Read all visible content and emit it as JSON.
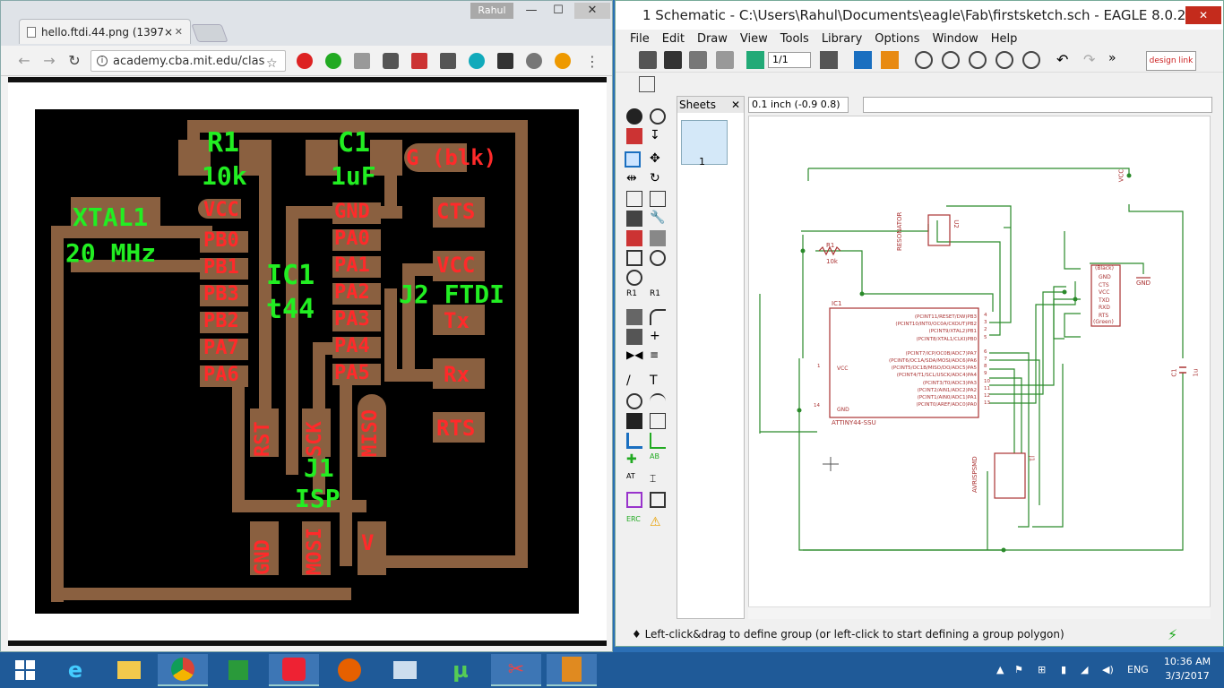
{
  "chrome": {
    "user": "Rahul",
    "tab_title": "hello.ftdi.44.png (1397×",
    "url": "academy.cba.mit.edu/clas",
    "min": "—",
    "max": "☐",
    "close": "✕"
  },
  "pcb": {
    "labels": [
      {
        "text": "R1",
        "color": "green"
      },
      {
        "text": "10k",
        "color": "green"
      },
      {
        "text": "C1",
        "color": "green"
      },
      {
        "text": "1uF",
        "color": "green"
      },
      {
        "text": "G (blk)",
        "color": "red"
      },
      {
        "text": "XTAL1",
        "color": "green"
      },
      {
        "text": "20 MHz",
        "color": "green"
      },
      {
        "text": "VCC",
        "color": "red"
      },
      {
        "text": "PB0",
        "color": "red"
      },
      {
        "text": "PB1",
        "color": "red"
      },
      {
        "text": "PB3",
        "color": "red"
      },
      {
        "text": "PB2",
        "color": "red"
      },
      {
        "text": "PA7",
        "color": "red"
      },
      {
        "text": "PA6",
        "color": "red"
      },
      {
        "text": "IC1",
        "color": "green"
      },
      {
        "text": "t44",
        "color": "green"
      },
      {
        "text": "GND",
        "color": "red"
      },
      {
        "text": "PA0",
        "color": "red"
      },
      {
        "text": "PA1",
        "color": "red"
      },
      {
        "text": "PA2",
        "color": "red"
      },
      {
        "text": "PA3",
        "color": "red"
      },
      {
        "text": "PA4",
        "color": "red"
      },
      {
        "text": "PA5",
        "color": "red"
      },
      {
        "text": "CTS",
        "color": "red"
      },
      {
        "text": "VCC",
        "color": "red"
      },
      {
        "text": "J2 FTDI",
        "color": "green"
      },
      {
        "text": "Tx",
        "color": "red"
      },
      {
        "text": "Rx",
        "color": "red"
      },
      {
        "text": "RTS",
        "color": "red"
      },
      {
        "text": "RST",
        "color": "red"
      },
      {
        "text": "SCK",
        "color": "red"
      },
      {
        "text": "MISO",
        "color": "red"
      },
      {
        "text": "J1",
        "color": "green"
      },
      {
        "text": "ISP",
        "color": "green"
      },
      {
        "text": "GND",
        "color": "red"
      },
      {
        "text": "MOSI",
        "color": "red"
      },
      {
        "text": "V",
        "color": "red"
      }
    ]
  },
  "eagle": {
    "title": "1 Schematic - C:\\Users\\Rahul\\Documents\\eagle\\Fab\\firstsketch.sch - EAGLE 8.0.2 ...",
    "menu": [
      "File",
      "Edit",
      "Draw",
      "View",
      "Tools",
      "Library",
      "Options",
      "Window",
      "Help"
    ],
    "sheet_select": "1/1",
    "sheets_label": "Sheets",
    "sheet_number": "1",
    "coord": "0.1 inch (-0.9 0.8)",
    "design_link": "design link",
    "status": "Left-click&drag to define group (or left-click to start defining a group polygon)",
    "schematic": {
      "vcc": "VCC",
      "gnd": "GND",
      "r1": "R1",
      "r1_val": "10k",
      "resonator": "RESONATOR",
      "u2": "U2",
      "ic1": "IC1",
      "ic1_part": "ATTINY44-SSU",
      "ic_vcc": "VCC",
      "ic_gnd": "GND",
      "c1": "C1",
      "c1_val": "1u",
      "avrisp": "AVRISPSMD",
      "j1": "J1",
      "ftdi_black": "(Black)",
      "ftdi_green": "(Green)",
      "ftdi_pins": [
        "GND",
        "CTS",
        "VCC",
        "TXD",
        "RXD",
        "RTS"
      ],
      "ic_pins": [
        "(PCINT11/RESET/DW)PB3",
        "(PCINT10/INT0/OC0A/CKOUT)PB2",
        "(PCINT9/XTAL2)PB1",
        "(PCINT8/XTAL1/CLKI)PB0",
        "(PCINT7/ICP/OC0B/ADC7)PA7",
        "(PCINT6/OC1A/SDA/MOSI/ADC6)PA6",
        "(PCINT5/OC1B/MISO/DO/ADC5)PA5",
        "(PCINT4/T1/SCL/USCK/ADC4)PA4",
        "(PCINT3/T0/ADC3)PA3",
        "(PCINT2/AIN1/ADC2)PA2",
        "(PCINT1/AIN0/ADC1)PA1",
        "(PCINT0/AREF/ADC0)PA0"
      ],
      "ic_pin_numbers": [
        "4",
        "3",
        "2",
        "5",
        "6",
        "7",
        "8",
        "9",
        "10",
        "11",
        "12",
        "13",
        "1",
        "14"
      ]
    }
  },
  "taskbar": {
    "lang": "ENG",
    "time": "10:36 AM",
    "date": "3/3/2017"
  }
}
